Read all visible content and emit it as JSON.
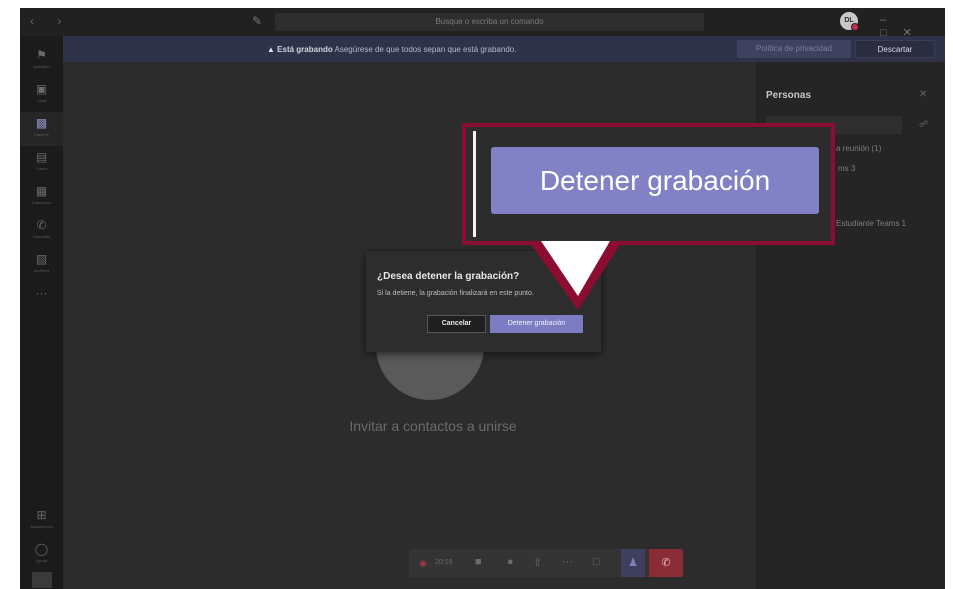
{
  "titlebar": {
    "search_placeholder": "Busque o escriba un comando",
    "avatar_initials": "DL"
  },
  "rail": {
    "items": [
      {
        "label": "Actividad",
        "icon": "bell-icon"
      },
      {
        "label": "Chat",
        "icon": "chat-icon"
      },
      {
        "label": "Equipos",
        "icon": "teams-icon"
      },
      {
        "label": "Tareas",
        "icon": "assignments-icon"
      },
      {
        "label": "Calendario",
        "icon": "calendar-icon"
      },
      {
        "label": "Llamadas",
        "icon": "phone-icon"
      },
      {
        "label": "Archivos",
        "icon": "files-icon"
      }
    ],
    "bottom": [
      {
        "label": "Aplicaciones",
        "icon": "apps-icon"
      },
      {
        "label": "Ayuda",
        "icon": "help-icon"
      }
    ]
  },
  "banner": {
    "bold": "Está grabando",
    "text": "Asegúrese de que todos sepan que está grabando.",
    "privacy_label": "Política de privacidad",
    "dismiss_label": "Descartar"
  },
  "stage": {
    "invite_text": "Invitar a contactos a unirse"
  },
  "callbar": {
    "timer": "20:19"
  },
  "panel": {
    "title": "Personas",
    "group_label": "a reunión (1)",
    "group_sub": "ms 3",
    "person_name": "Estudiante Teams 1"
  },
  "dialog": {
    "title": "¿Desea detener la grabación?",
    "text": "Si la detiene, la grabación finalizará en este punto.",
    "cancel_label": "Cancelar",
    "stop_label": "Detener grabación"
  },
  "zoom": {
    "button_label": "Detener grabación"
  },
  "colors": {
    "accent": "#7b7cc2",
    "highlight_border": "#8b0d32",
    "hangup": "#8a2c36"
  }
}
